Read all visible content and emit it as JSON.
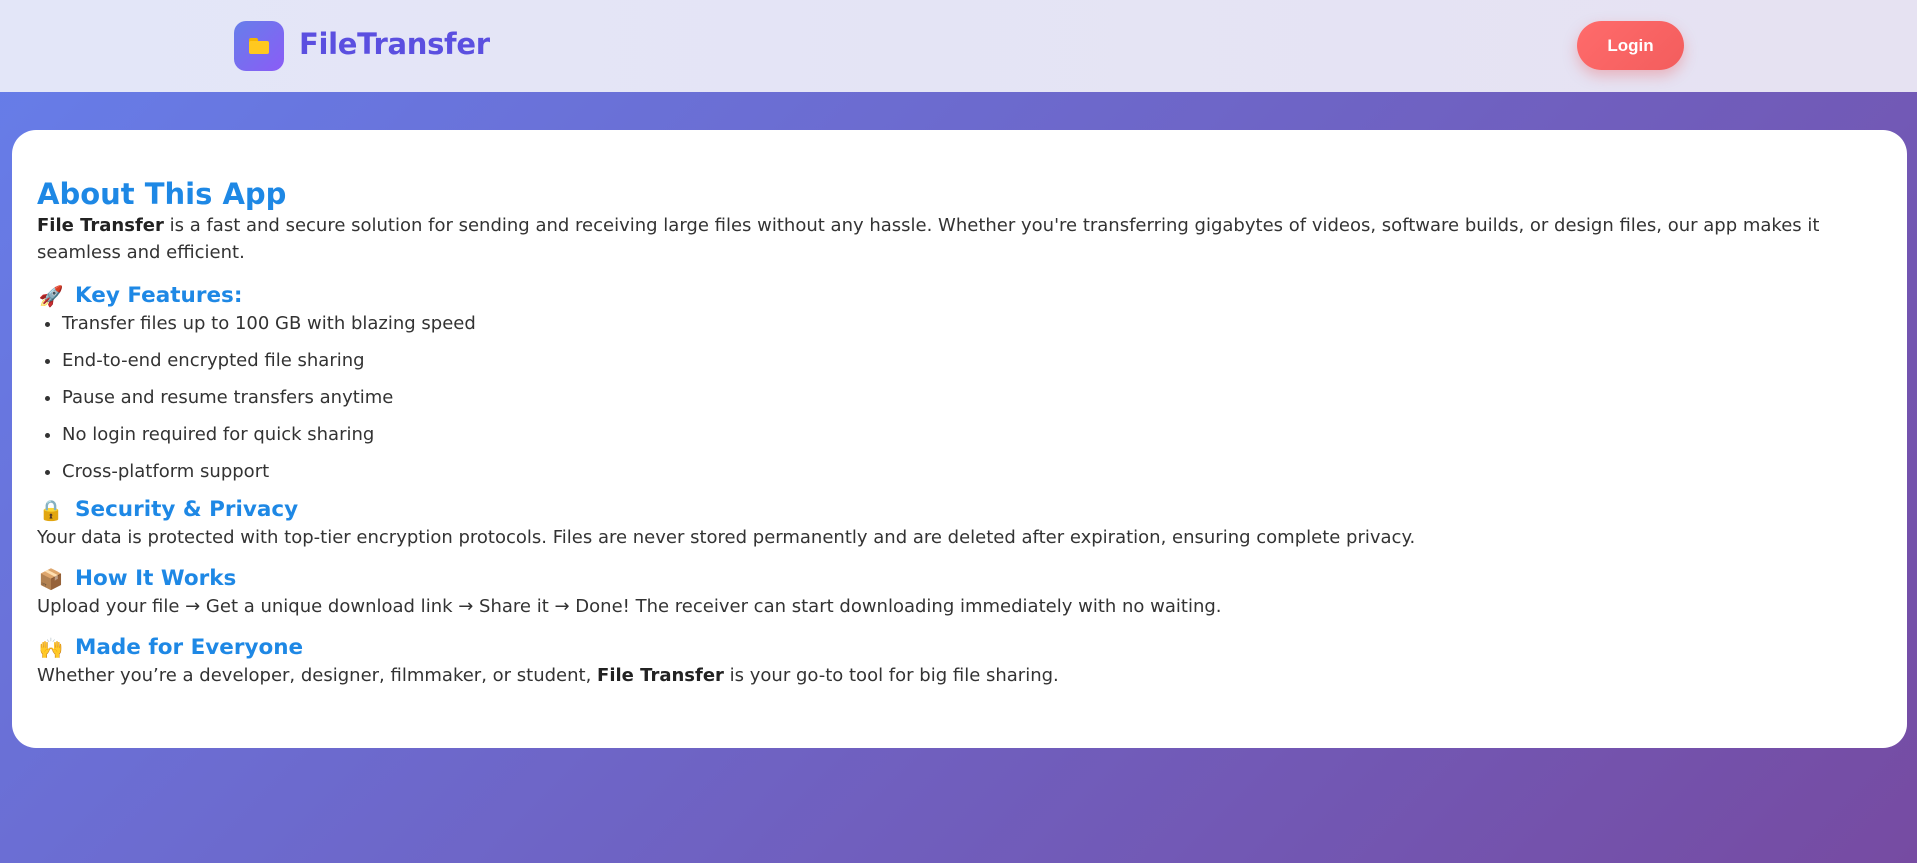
{
  "header": {
    "logo_icon": "folder-icon",
    "brand": "FileTransfer",
    "login_label": "Login",
    "colors": {
      "brand": "#5b4fe0",
      "login": "#ff6b6b"
    }
  },
  "about": {
    "title": "About This App",
    "intro_bold": "File Transfer",
    "intro_rest": " is a fast and secure solution for sending and receiving large files without any hassle. Whether you're transferring gigabytes of videos, software builds, or design files, our app makes it seamless and efficient.",
    "features": {
      "icon": "rocket-icon",
      "emoji": "🚀",
      "heading": "Key Features:",
      "items": [
        "Transfer files up to 100 GB with blazing speed",
        "End-to-end encrypted file sharing",
        "Pause and resume transfers anytime",
        "No login required for quick sharing",
        "Cross-platform support"
      ]
    },
    "security": {
      "icon": "lock-icon",
      "emoji": "🔒",
      "heading": "Security & Privacy",
      "text": "Your data is protected with top-tier encryption protocols. Files are never stored permanently and are deleted after expiration, ensuring complete privacy."
    },
    "how": {
      "icon": "package-icon",
      "emoji": "📦",
      "heading": "How It Works",
      "text": "Upload your file → Get a unique download link → Share it → Done! The receiver can start downloading immediately with no waiting."
    },
    "everyone": {
      "icon": "raised-hands-icon",
      "emoji": "🙌",
      "heading": "Made for Everyone",
      "text_before": "Whether you’re a developer, designer, filmmaker, or student, ",
      "text_bold": "File Transfer",
      "text_after": " is your go-to tool for big file sharing."
    }
  },
  "colors": {
    "heading": "#1e88e5",
    "card_bg": "#ffffff",
    "gradient_start": "#667eea",
    "gradient_end": "#764ba2"
  }
}
